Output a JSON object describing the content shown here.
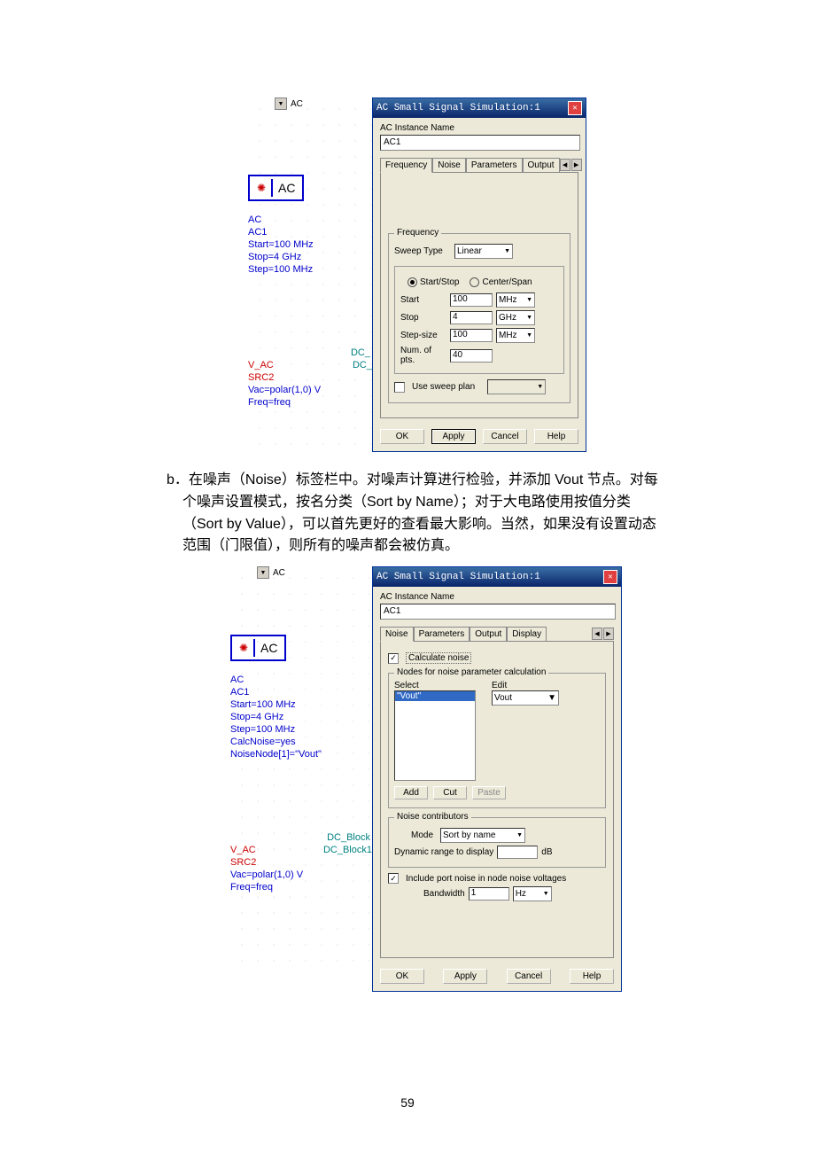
{
  "fig1": {
    "sch": {
      "topLabel": "AC",
      "acBox": "AC",
      "l1": "AC",
      "l2": "AC1",
      "l3": "Start=100 MHz",
      "l4": "Stop=4 GHz",
      "l5": "Step=100 MHz",
      "dc1": "DC_",
      "dc2": "DC_",
      "vac": "V_AC",
      "src": "SRC2",
      "vacEq": "Vac=polar(1,0) V",
      "freq": "Freq=freq"
    },
    "dlg": {
      "title": "AC Small Signal Simulation:1",
      "instLabel": "AC Instance Name",
      "instVal": "AC1",
      "tabs": {
        "t1": "Frequency",
        "t2": "Noise",
        "t3": "Parameters",
        "t4": "Output"
      },
      "group": "Frequency",
      "sweepLabel": "Sweep Type",
      "sweepVal": "Linear",
      "radio1": "Start/Stop",
      "radio2": "Center/Span",
      "rows": {
        "start": {
          "lbl": "Start",
          "val": "100",
          "unit": "MHz"
        },
        "stop": {
          "lbl": "Stop",
          "val": "4",
          "unit": "GHz"
        },
        "step": {
          "lbl": "Step-size",
          "val": "100",
          "unit": "MHz"
        },
        "num": {
          "lbl": "Num. of pts.",
          "val": "40"
        }
      },
      "useSweep": "Use sweep plan",
      "btns": {
        "ok": "OK",
        "apply": "Apply",
        "cancel": "Cancel",
        "help": "Help"
      }
    }
  },
  "bodyText": {
    "prefix": "b．",
    "line1": "在噪声（Noise）标签栏中。对噪声计算进行检验，并添加 Vout 节点。对每个噪声设置模式，按名分类（Sort by Name）；对于大电路使用按值分类 （Sort by Value），可以首先更好的查看最大影响。当然，如果没有设置动态范围（门限值），则所有的噪声都会被仿真。"
  },
  "fig2": {
    "sch": {
      "topLabel": "AC",
      "acBox": "AC",
      "l1": "AC",
      "l2": "AC1",
      "l3": "Start=100 MHz",
      "l4": "Stop=4 GHz",
      "l5": "Step=100 MHz",
      "l6": "CalcNoise=yes",
      "l7": "NoiseNode[1]=\"Vout\"",
      "dc1": "DC_Block",
      "dc2": "DC_Block1",
      "vac": "V_AC",
      "src": "SRC2",
      "vacEq": "Vac=polar(1,0) V",
      "freq": "Freq=freq"
    },
    "dlg": {
      "title": "AC Small Signal Simulation:1",
      "instLabel": "AC Instance Name",
      "instVal": "AC1",
      "tabs": {
        "t1": "Noise",
        "t2": "Parameters",
        "t3": "Output",
        "t4": "Display"
      },
      "calcNoise": "Calculate noise",
      "nodesGroup": "Nodes for noise parameter calculation",
      "selectLbl": "Select",
      "editLbl": "Edit",
      "listItem": "\"Vout\"",
      "editVal": "Vout",
      "btnAdd": "Add",
      "btnCut": "Cut",
      "btnPaste": "Paste",
      "contribGroup": "Noise contributors",
      "modeLbl": "Mode",
      "modeVal": "Sort by name",
      "dynLbl": "Dynamic range to display",
      "dynUnit": "dB",
      "includeLbl": "Include port noise in node noise voltages",
      "bwLbl": "Bandwidth",
      "bwVal": "1",
      "bwUnit": "Hz",
      "btns": {
        "ok": "OK",
        "apply": "Apply",
        "cancel": "Cancel",
        "help": "Help"
      }
    }
  },
  "pageNumber": "59"
}
